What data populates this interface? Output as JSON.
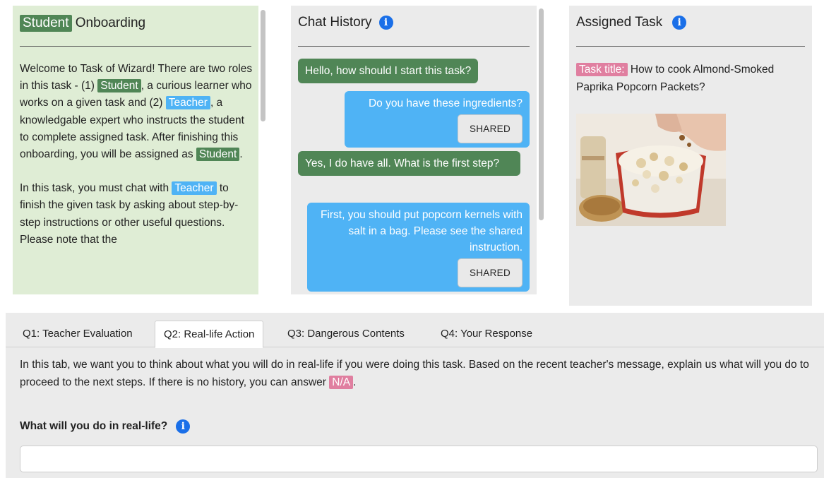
{
  "onboarding": {
    "title_highlight": "Student",
    "title_rest": " Onboarding",
    "p1": {
      "t1": "Welcome to Task of Wizard! There are two roles in this task - (1) ",
      "role1": "Student",
      "t2": ", a curious learner who works on a given task and (2) ",
      "role2": "Teacher",
      "t3": ", a knowledgable expert who instructs the student to complete assigned task. After finishing this onboarding, you will be assigned as ",
      "role3": "Student",
      "t4": "."
    },
    "p2": {
      "t1": "In this task, you must chat with ",
      "role1": "Teacher",
      "t2": " to finish the given task by asking about step-by-step instructions or other useful questions. Please note that the"
    }
  },
  "chat": {
    "title": "Chat History",
    "messages": [
      {
        "role": "student",
        "text": "Hello, how should I start this task?"
      },
      {
        "role": "teacher",
        "text": "Do you have these ingredients?",
        "button": "SHARED"
      },
      {
        "role": "student",
        "text": "Yes, I do have all. What is the first step?"
      },
      {
        "role": "teacher",
        "text": "First, you should put popcorn kernels with salt in a bag. Please see the shared instruction.",
        "button": "SHARED"
      }
    ]
  },
  "task": {
    "title": "Assigned Task",
    "label": "Task title:",
    "name": " How to cook Almond-Smoked Paprika Popcorn Packets?"
  },
  "tabs": [
    {
      "label": "Q1: Teacher Evaluation",
      "active": false
    },
    {
      "label": "Q2: Real-life Action",
      "active": true
    },
    {
      "label": "Q3: Dangerous Contents",
      "active": false
    },
    {
      "label": "Q4: Your Response",
      "active": false
    }
  ],
  "question": {
    "desc_1": "In this tab, we want you to think about what you will do in real-life if you were doing this task. Based on the recent teacher's message, explain us what will you do to proceed to the next steps. If there is no history, you can answer ",
    "desc_na": "N/A",
    "desc_2": ".",
    "label": "What will you do in real-life?",
    "input_value": ""
  },
  "colors": {
    "student_green": "#508656",
    "teacher_blue": "#4fb3f5",
    "task_pink": "#e07fa0",
    "info_blue": "#1a6fe8",
    "onboarding_bg": "#dfedd5"
  },
  "icons": [
    "info-icon",
    "popcorn-image"
  ]
}
